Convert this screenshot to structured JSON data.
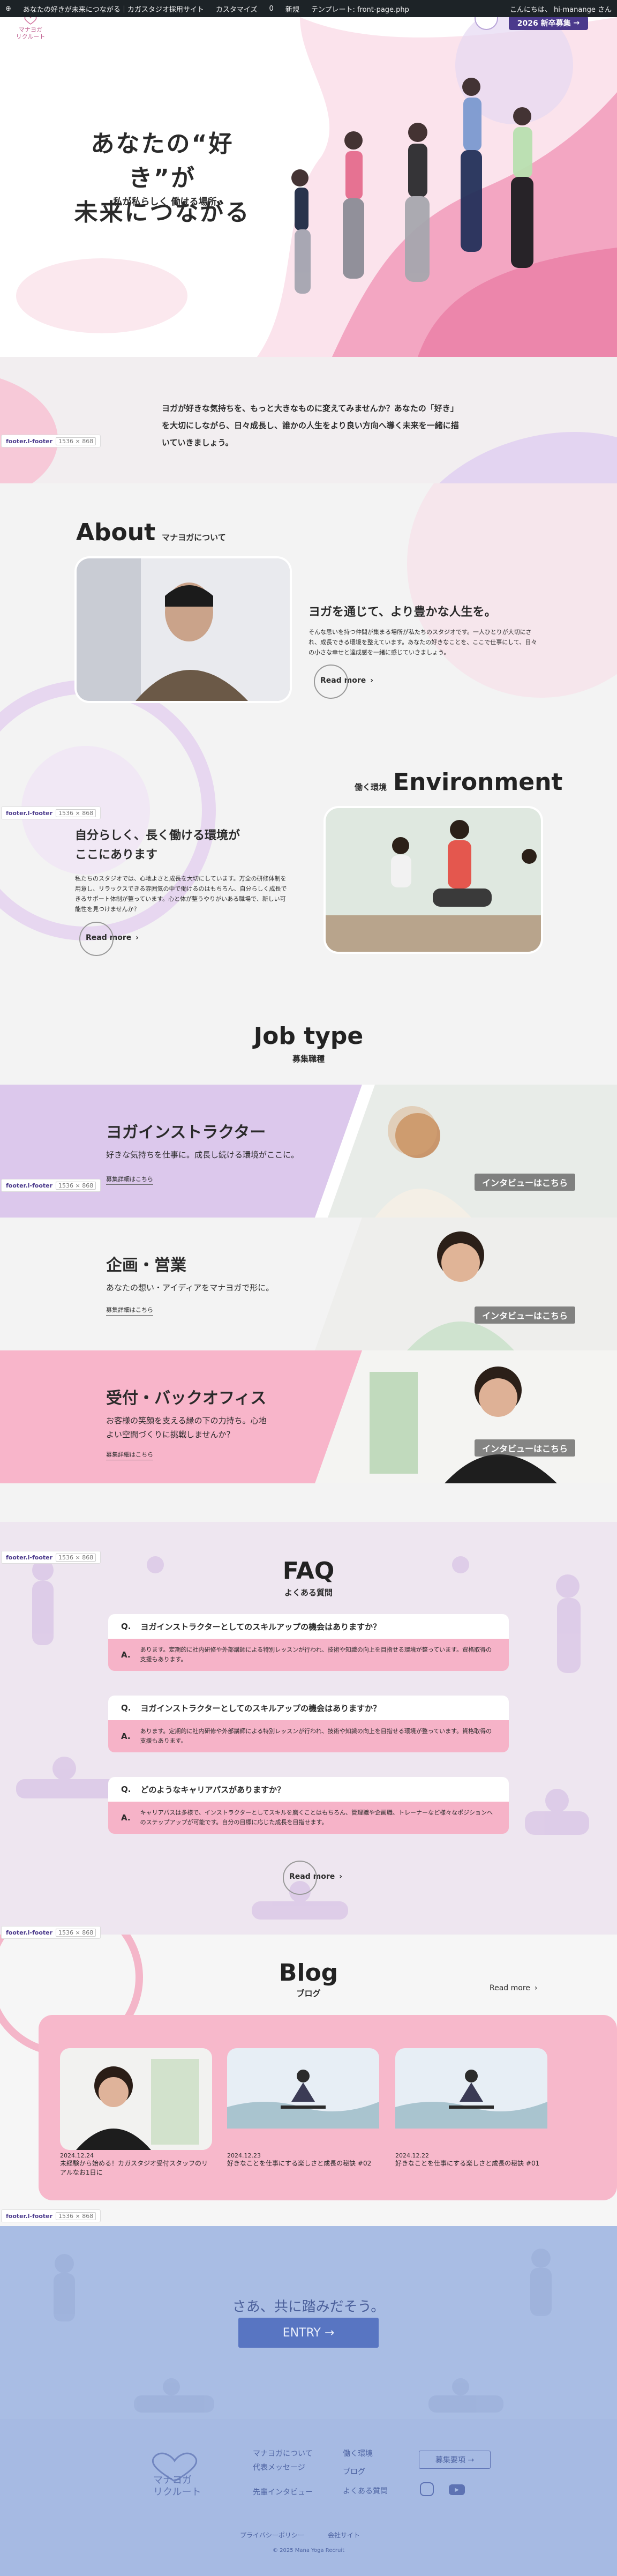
{
  "admin_bar": {
    "site": "あなたの好きが未来につながる｜カガスタジオ採用サイト",
    "customize": "カスタマイズ",
    "comments": "0",
    "new": "新規",
    "template": "テンプレート: front-page.php",
    "greeting": "こんにちは、 hi-manange さん"
  },
  "header": {
    "logo_text": "マナヨガ\nリクルート",
    "cta": "2026 '新卒募集'",
    "cta_label": "2026 新卒募集"
  },
  "hero": {
    "title_line1": "あなたの“好き”が",
    "title_line2": "未来につながる",
    "subtitle": "私が私らしく 働ける場所"
  },
  "intro": {
    "text": "ヨガが好きな気持ちを、もっと大きなものに変えてみませんか？あなたの「好き」を大切にしながら、日々成長し、誰かの人生をより良い方向へ導く未来を一緒に描いていきましょう。"
  },
  "footer_pill": {
    "name": "footer.l-footer",
    "size": "1536 × 868"
  },
  "about": {
    "heading_en": "About",
    "heading_jp": "マナヨガについて",
    "lead": "ヨガを通じて、より豊かな人生を。",
    "body": "そんな思いを持つ仲間が集まる場所が私たちのスタジオです。一人ひとりが大切にされ、成長できる環境を整えています。あなたの好きなことを、ここで仕事にして、日々の小さな幸せと達成感を一緒に感じていきましょう。",
    "read_more": "Read more"
  },
  "environment": {
    "heading_en": "Environment",
    "heading_jp": "働く環境",
    "lead_line1": "自分らしく、長く働ける環境が",
    "lead_line2": "ここにあります",
    "body": "私たちのスタジオでは、心地よさと成長を大切にしています。万全の研修体制を用意し、リラックスできる雰囲気の中で働けるのはもちろん、自分らしく成長できるサポート体制が整っています。心と体が整うやりがいある職場で、新しい可能性を見つけませんか？",
    "read_more": "Read more"
  },
  "job_type": {
    "heading_en": "Job type",
    "heading_jp": "募集職種",
    "jobs": [
      {
        "title": "ヨガインストラクター",
        "desc": "好きな気持ちを仕事に。成長し続ける環境がここに。",
        "link": "募集詳細はこちら",
        "interview": "インタビューはこちら"
      },
      {
        "title": "企画・営業",
        "desc": "あなたの想い・アイディアをマナヨガで形に。",
        "link": "募集詳細はこちら",
        "interview": "インタビューはこちら"
      },
      {
        "title": "受付・バックオフィス",
        "desc": "お客様の笑顔を支える縁の下の力持ち。心地よい空間づくりに挑戦しませんか？",
        "link": "募集詳細はこちら",
        "interview": "インタビューはこちら"
      }
    ]
  },
  "faq": {
    "heading_en": "FAQ",
    "heading_jp": "よくある質問",
    "items": [
      {
        "q": "ヨガインストラクターとしてのスキルアップの機会はありますか？",
        "a": "あります。定期的に社内研修や外部講師による特別レッスンが行われ、技術や知識の向上を目指せる環境が整っています。資格取得の支援もあります。"
      },
      {
        "q": "ヨガインストラクターとしてのスキルアップの機会はありますか？",
        "a": "あります。定期的に社内研修や外部講師による特別レッスンが行われ、技術や知識の向上を目指せる環境が整っています。資格取得の支援もあります。"
      },
      {
        "q": "どのようなキャリアパスがありますか？",
        "a": "キャリアパスは多様で、インストラクターとしてスキルを磨くことはもちろん、管理職や企画職、トレーナーなど様々なポジションへのステップアップが可能です。自分の目標に応じた成長を目指せます。"
      }
    ],
    "q_mark": "Q.",
    "a_mark": "A.",
    "read_more": "Read more"
  },
  "blog": {
    "heading_en": "Blog",
    "heading_jp": "ブログ",
    "read_more": "Read more",
    "posts": [
      {
        "date": "2024.12.24",
        "title": "未経験から始める！カガスタジオ受付スタッフのリアルなお1日に"
      },
      {
        "date": "2024.12.23",
        "title": "好きなことを仕事にする楽しさと成長の秘訣 #02"
      },
      {
        "date": "2024.12.22",
        "title": "好きなことを仕事にする楽しさと成長の秘訣 #01"
      }
    ]
  },
  "footer": {
    "cta_text": "さあ、共に踏みだそう。",
    "entry": "ENTRY →",
    "logo": "マナヨガ\nリクルート",
    "links": [
      "マナヨガについて",
      "代表メッセージ",
      "先輩インタビュー",
      "働く環境",
      "ブログ",
      "よくある質問"
    ],
    "recruit_btn": "募集要項 →",
    "privacy": "プライバシーポリシー",
    "sitemap": "会社サイト",
    "copyright": "© 2025 Mana Yoga Recruit"
  },
  "colors": {
    "purple": "#4b3a8c",
    "pink": "#f6b3c8",
    "lavender": "#d9c8ec",
    "footer_blue": "#a9bde4"
  }
}
